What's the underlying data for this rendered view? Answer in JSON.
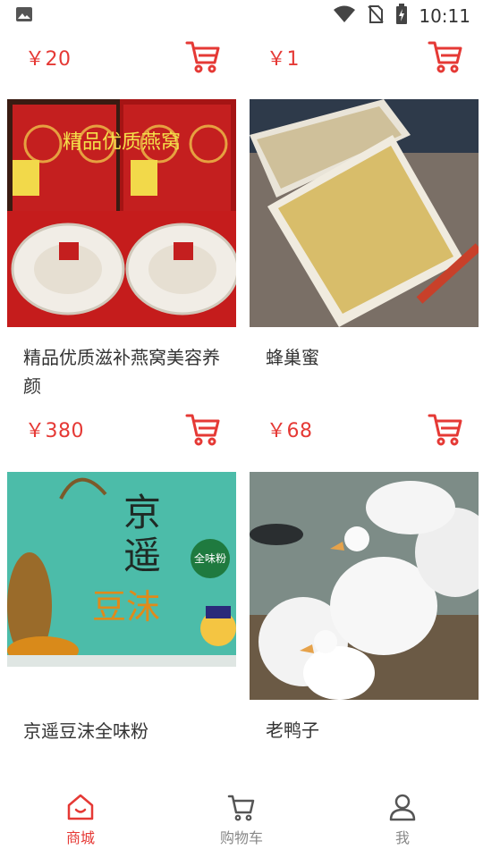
{
  "status_bar": {
    "time": "10:11",
    "icons": [
      "image-icon",
      "wifi-icon",
      "no-sim-icon",
      "battery-charging-icon"
    ]
  },
  "products_top": [
    {
      "price": "￥20"
    },
    {
      "price": "￥1"
    }
  ],
  "products": [
    {
      "name": "精品优质滋补燕窝美容养颜",
      "price": "￥380",
      "image_caption": "精品优质燕窝",
      "image_colors": {
        "base": "#b01818",
        "accent": "#d9c58a"
      }
    },
    {
      "name": "蜂巢蜜",
      "price": "￥68",
      "image_colors": {
        "base": "#8a7a6a",
        "accent": "#d9b56a"
      }
    },
    {
      "name": "京遥豆沫全味粉",
      "price": "",
      "image_caption": "京遥",
      "image_subcaption": "豆沫",
      "image_badge": "全味粉",
      "image_colors": {
        "base": "#49b9a7",
        "accent": "#d98a1a"
      }
    },
    {
      "name": "老鸭子",
      "price": "",
      "image_colors": {
        "base": "#7c8b86",
        "accent": "#f2f2f2"
      }
    }
  ],
  "bottom_nav": {
    "items": [
      {
        "label": "商城",
        "icon": "home-icon",
        "active": true
      },
      {
        "label": "购物车",
        "icon": "cart-icon",
        "active": false
      },
      {
        "label": "我",
        "icon": "user-icon",
        "active": false
      }
    ]
  },
  "colors": {
    "accent": "#e53935",
    "text": "#333333",
    "inactive": "#888888"
  }
}
